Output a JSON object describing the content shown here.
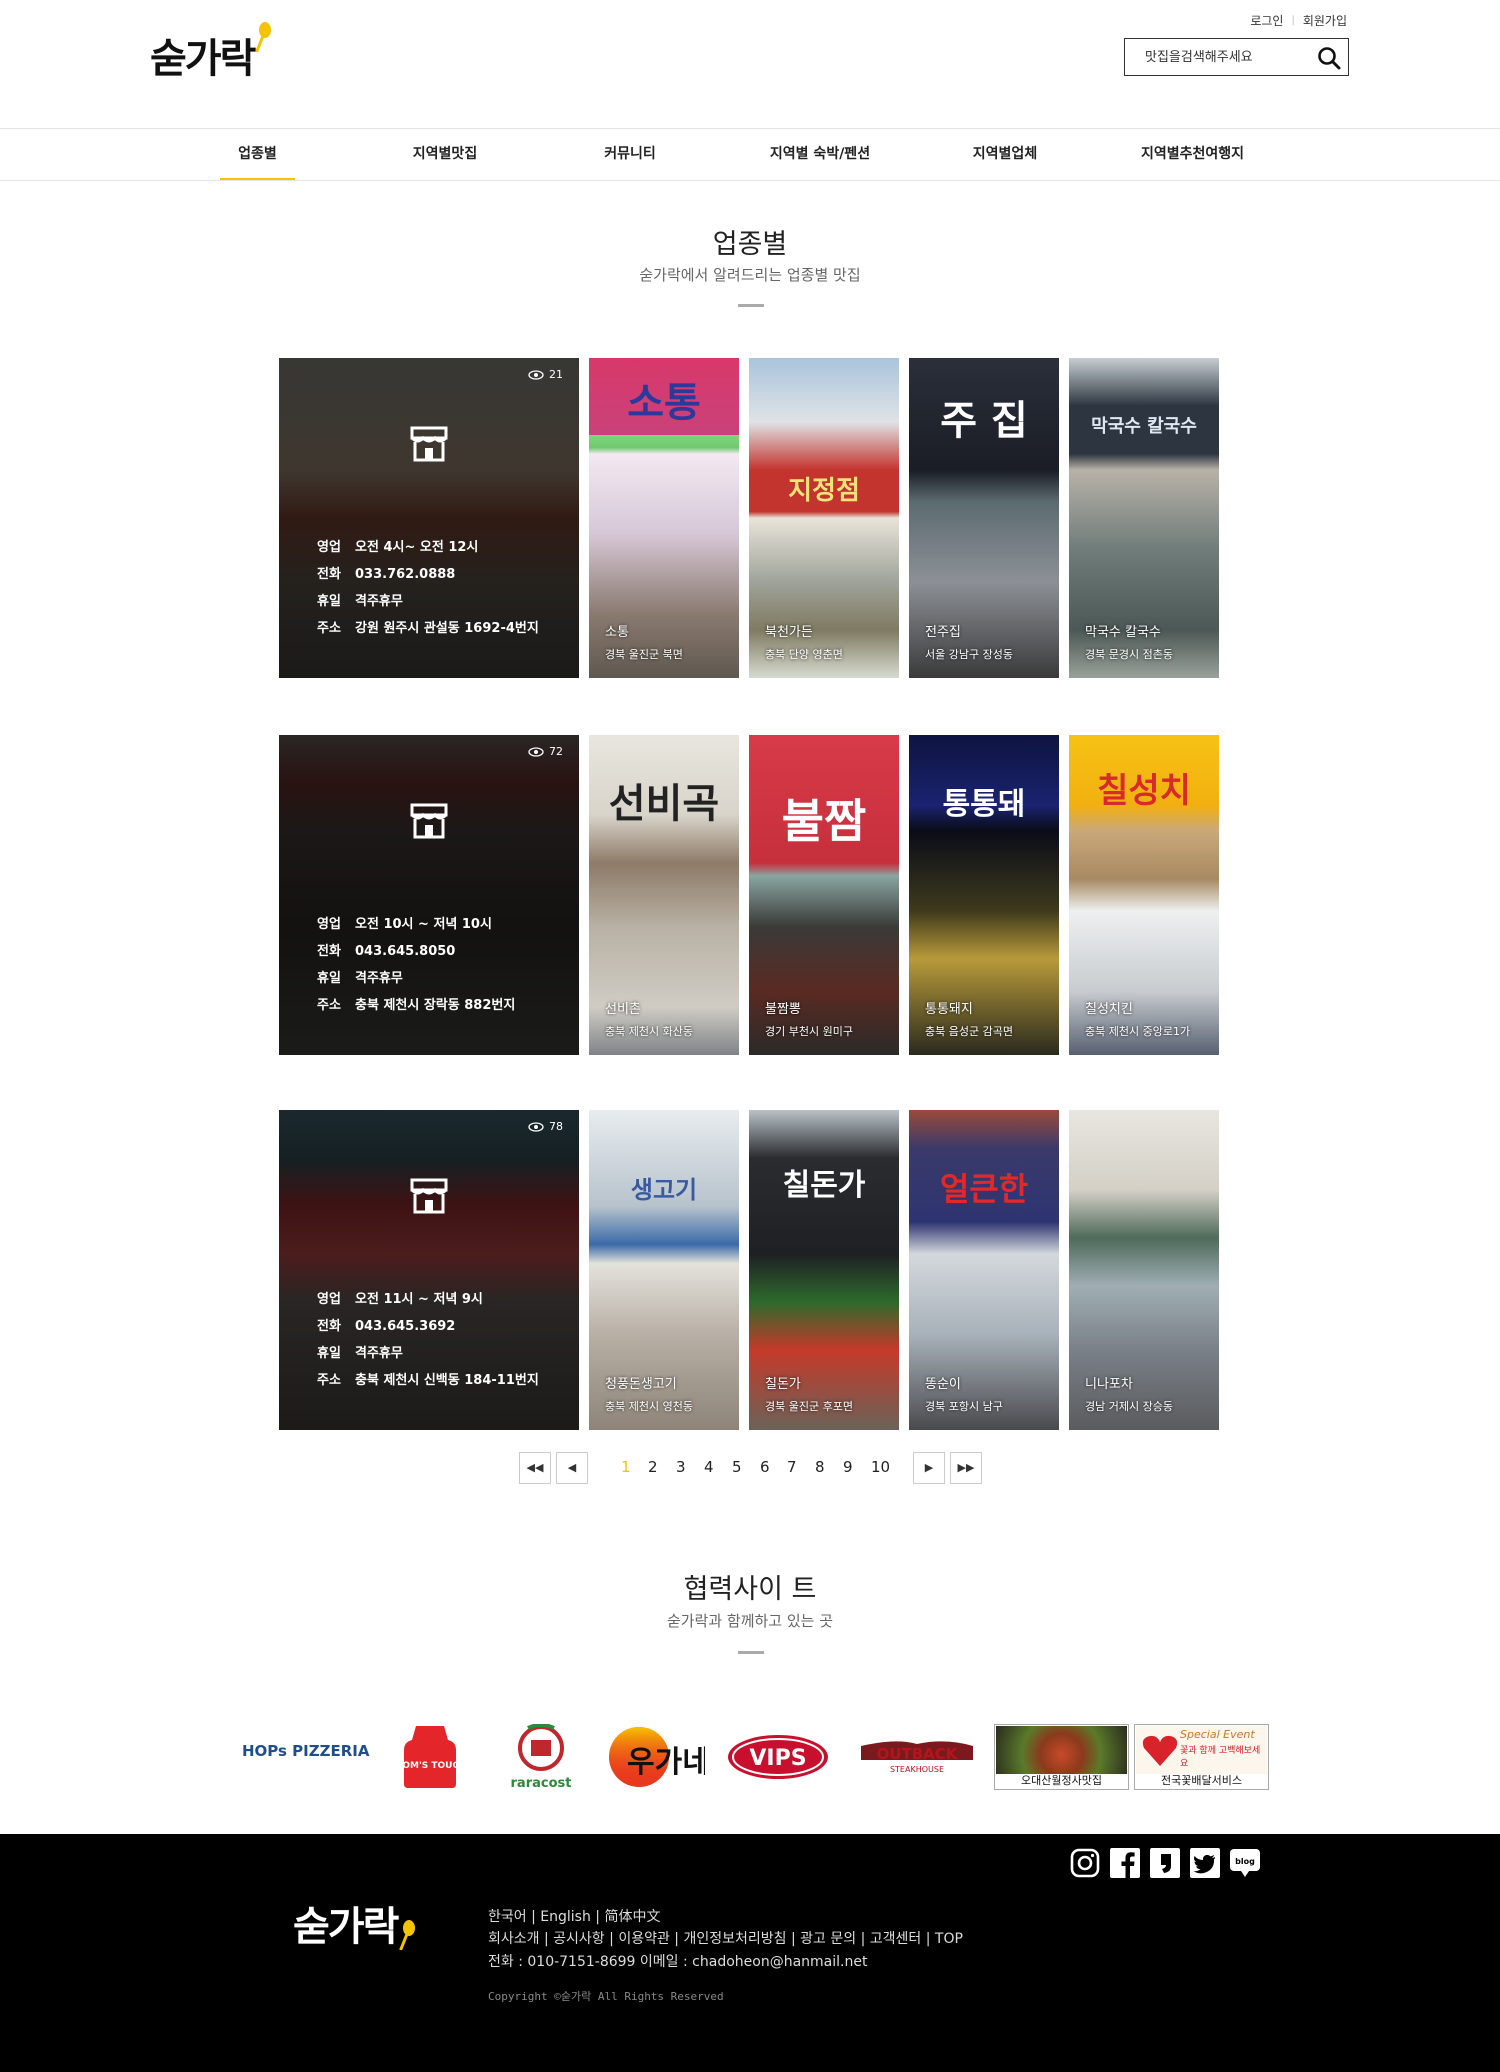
{
  "header": {
    "logo": "숟가락",
    "login": "로그인",
    "signup": "회원가입",
    "search_placeholder": "맛집을검색해주세요"
  },
  "nav": [
    "업종별",
    "지역별맛집",
    "커뮤니티",
    "지역별 숙박/펜션",
    "지역별업체",
    "지역별추천여행지"
  ],
  "section": {
    "title": "업종별",
    "subtitle": "숟가락에서 알려드리는 업종별 맛집"
  },
  "rows": [
    {
      "feature": {
        "views": "21",
        "hours_label": "영업",
        "hours": "오전 4시~ 오전 12시",
        "phone_label": "전화",
        "phone": "033.762.0888",
        "off_label": "휴일",
        "off": "격주휴무",
        "addr_label": "주소",
        "addr": "강원 원주시 관설동 1692-4번지"
      },
      "thumbs": [
        {
          "name": "소통",
          "addr": "경북 울진군 북면",
          "sign": "소통"
        },
        {
          "name": "북천가든",
          "addr": "충북 단양 영춘면",
          "sign": "지정점"
        },
        {
          "name": "전주집",
          "addr": "서울 강남구 장성동",
          "sign": "주 집"
        },
        {
          "name": "막국수 칼국수",
          "addr": "경북 문경시 점촌동",
          "sign": "막국수 칼국수"
        }
      ]
    },
    {
      "feature": {
        "views": "72",
        "hours_label": "영업",
        "hours": "오전 10시 ~ 저녁 10시",
        "phone_label": "전화",
        "phone": "043.645.8050",
        "off_label": "휴일",
        "off": "격주휴무",
        "addr_label": "주소",
        "addr": "충북 제천시 장락동 882번지"
      },
      "thumbs": [
        {
          "name": "선비촌",
          "addr": "충북 제천시 화산동",
          "sign": "선비곡"
        },
        {
          "name": "불짬뽕",
          "addr": "경기 부천시 원미구",
          "sign": "불짬"
        },
        {
          "name": "통통돼지",
          "addr": "충북 음성군 감곡면",
          "sign": "통통돼"
        },
        {
          "name": "칠성치킨",
          "addr": "충북 제천시 중앙로1가",
          "sign": "칠성치"
        }
      ]
    },
    {
      "feature": {
        "views": "78",
        "hours_label": "영업",
        "hours": "오전 11시 ~ 저녁 9시",
        "phone_label": "전화",
        "phone": "043.645.3692",
        "off_label": "휴일",
        "off": "격주휴무",
        "addr_label": "주소",
        "addr": "충북 제천시 신백동 184-11번지"
      },
      "thumbs": [
        {
          "name": "청풍돈생고기",
          "addr": "충북 제천시 영천동",
          "sign": "생고기"
        },
        {
          "name": "칠돈가",
          "addr": "경북 울진군 후포면",
          "sign": "칠돈가"
        },
        {
          "name": "똥순이",
          "addr": "경북 포항시 남구",
          "sign": "얼큰한"
        },
        {
          "name": "니나포차",
          "addr": "경남 거제시 장승동",
          "sign": ""
        }
      ]
    }
  ],
  "pagination": {
    "pages": [
      "1",
      "2",
      "3",
      "4",
      "5",
      "6",
      "7",
      "8",
      "9",
      "10"
    ],
    "current": "1"
  },
  "partners": {
    "title": "협력사이 트",
    "subtitle": "숟가락과 함께하고 있는 곳",
    "logos": [
      "HOPs PIZZERIA",
      "MOM'S TOUCH",
      "raracost",
      "우가네",
      "VIPS",
      "OUTBACK STEAKHOUSE"
    ],
    "banners": [
      "오대산월정사맛집",
      "전국꽃배달서비스"
    ],
    "banner_event": "Special Event",
    "banner_event_sub": "꽃과 함께 고백해보세요"
  },
  "footer": {
    "logo": "숟가락",
    "langs": [
      "한국어",
      "English",
      "简体中文"
    ],
    "links": [
      "회사소개",
      "공시사항",
      "이용약관",
      "개인정보처리방침",
      "광고 문의",
      "고객센터",
      "TOP"
    ],
    "phone": "전화 : 010-7151-8699",
    "email": "이메일 : chadoheon@hanmail.net",
    "copyright": "Copyright ©숟가락  All Rights Reserved",
    "social": [
      "instagram-icon",
      "facebook-icon",
      "kakaostory-icon",
      "twitter-icon",
      "blog-icon"
    ]
  },
  "colors": {
    "accent": "#f5c400",
    "footer_bg": "#000000"
  }
}
